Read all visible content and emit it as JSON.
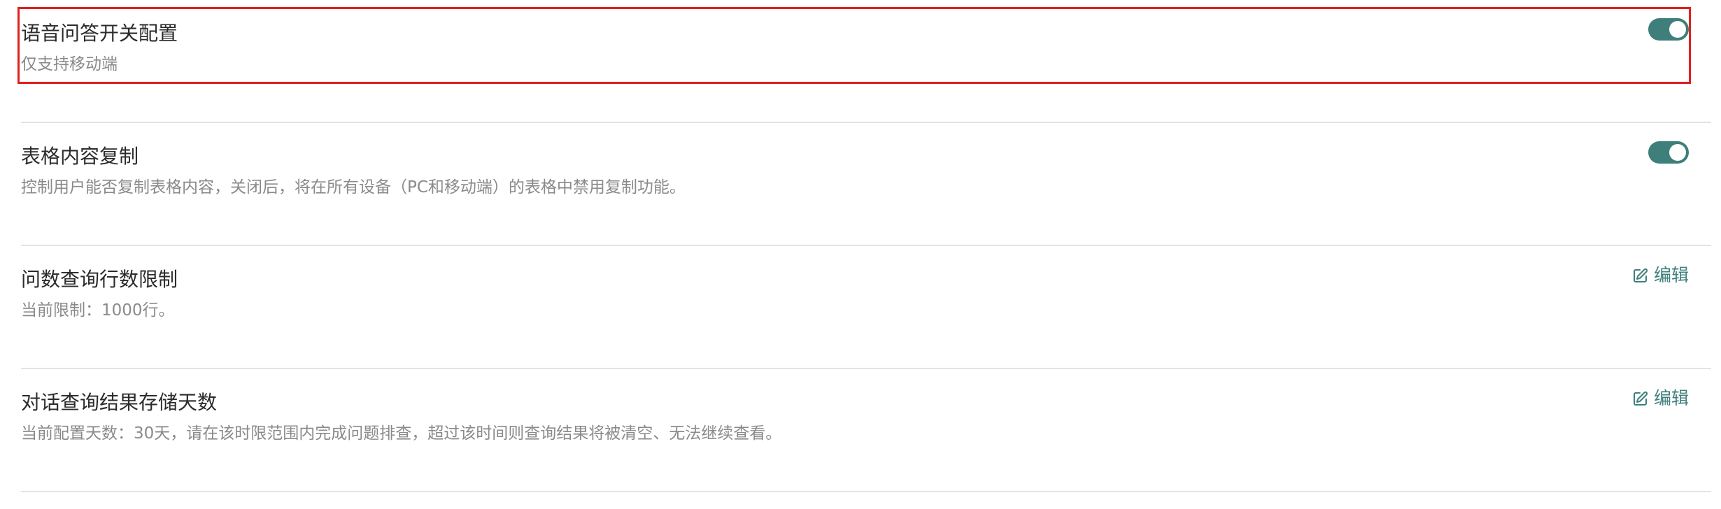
{
  "colors": {
    "accent": "#3f7f7b",
    "highlight": "#e0201b",
    "title_text": "#2b2b2b",
    "desc_text": "#8a8a8a",
    "divider": "#e3e3e3"
  },
  "settings": [
    {
      "title": "语音问答开关配置",
      "description": "仅支持移动端",
      "control": "toggle",
      "enabled": true
    },
    {
      "title": "表格内容复制",
      "description": "控制用户能否复制表格内容，关闭后，将在所有设备（PC和移动端）的表格中禁用复制功能。",
      "control": "toggle",
      "enabled": true
    },
    {
      "title": "问数查询行数限制",
      "description": "当前限制：1000行。",
      "control": "edit",
      "edit_label": "编辑",
      "edit_icon": "edit-icon"
    },
    {
      "title": "对话查询结果存储天数",
      "description": "当前配置天数：30天，请在该时限范围内完成问题排查，超过该时间则查询结果将被清空、无法继续查看。",
      "control": "edit",
      "edit_label": "编辑",
      "edit_icon": "edit-icon"
    }
  ]
}
